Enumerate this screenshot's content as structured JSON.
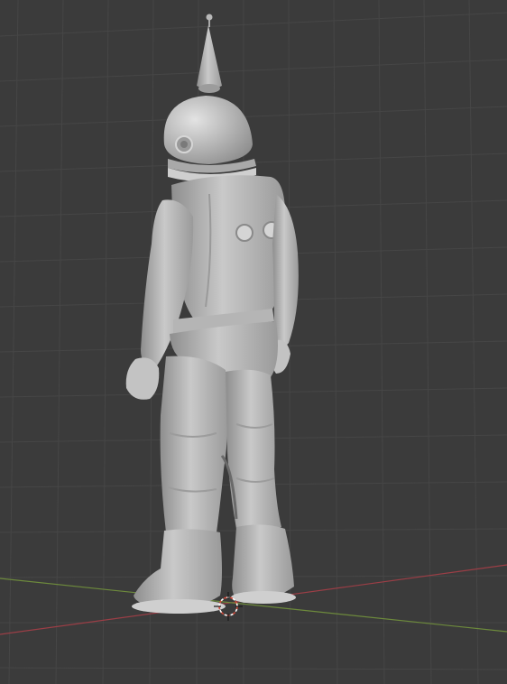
{
  "viewport": {
    "background_color": "#3b3b3b",
    "grid_color": "#454545",
    "x_axis_color": "#9b3e46",
    "y_axis_color": "#6d8a3c",
    "model_color": "#bdbdbd",
    "model_shadow_color": "#7d7d7d",
    "model_highlight_color": "#e6e6e6",
    "cursor_color": "#d44a3a",
    "object": "spacesuit-figure-model",
    "shading": "solid"
  }
}
